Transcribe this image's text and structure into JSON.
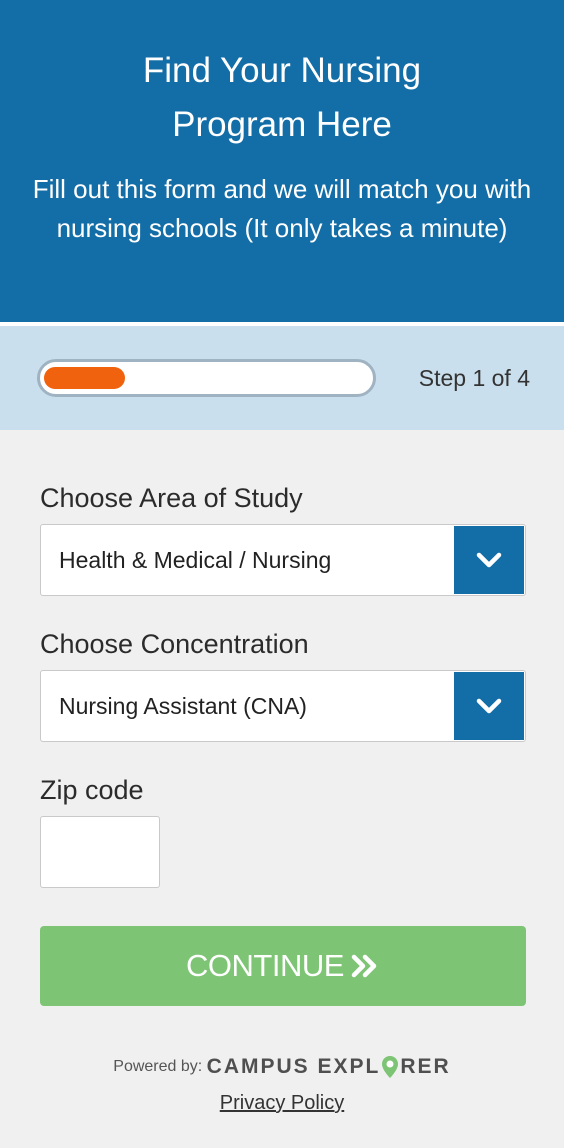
{
  "header": {
    "title": "Find Your Nursing Program Here",
    "subtitle": "Fill out this form and we will match you with nursing schools (It only takes a minute)"
  },
  "progress": {
    "step_label": "Step 1 of 4",
    "fraction": 0.25,
    "bar_color": "#f0620d"
  },
  "form": {
    "area_of_study": {
      "label": "Choose Area of Study",
      "selected": "Health & Medical / Nursing",
      "icon": "chevron-down-icon"
    },
    "concentration": {
      "label": "Choose Concentration",
      "selected": "Nursing Assistant (CNA)",
      "icon": "chevron-down-icon"
    },
    "zip": {
      "label": "Zip code",
      "value": "",
      "placeholder": ""
    },
    "continue_label": "CONTINUE",
    "continue_icon": "double-chevron-right-icon"
  },
  "footer": {
    "powered_by": "Powered by:",
    "brand_part1": "CAMPUS EXPL",
    "brand_part2": "RER",
    "privacy_label": "Privacy Policy"
  },
  "colors": {
    "primary": "#136da6",
    "progress_band": "#cadfed",
    "accent_orange": "#f0620d",
    "continue_green": "#7dc474",
    "brand_pin_green": "#7dc474"
  }
}
